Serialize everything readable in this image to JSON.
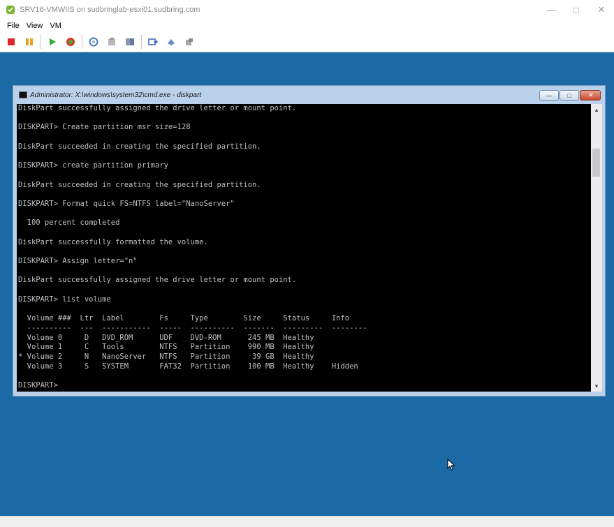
{
  "window": {
    "title": "SRV16-VMWIIS on sudbringlab-esxi01.sudbring.com",
    "controls": [
      "minimize",
      "maximize",
      "close"
    ]
  },
  "menu": {
    "items": [
      "File",
      "View",
      "VM"
    ]
  },
  "toolbar": {
    "buttons": [
      {
        "name": "power-off",
        "icon": "stop-icon",
        "color": "#e0262b"
      },
      {
        "name": "suspend",
        "icon": "pause-icon",
        "color": "#e8a21c"
      },
      {
        "name": "power-on",
        "icon": "play-icon",
        "color": "#37a83a"
      },
      {
        "name": "reset",
        "icon": "reset-icon",
        "color": "#d23b2a"
      },
      {
        "name": "snapshot",
        "icon": "snapshot-icon"
      },
      {
        "name": "revert-snapshot",
        "icon": "revert-snapshot-icon"
      },
      {
        "name": "manage-snapshots",
        "icon": "manage-snapshots-icon"
      },
      {
        "name": "full-screen",
        "icon": "full-screen-icon"
      },
      {
        "name": "send-ctrl-alt-del",
        "icon": "ctrl-alt-del-icon"
      },
      {
        "name": "settings",
        "icon": "settings-icon"
      }
    ]
  },
  "guest": {
    "background_color": "#1b6aa6"
  },
  "cmd": {
    "title": "Administrator: X:\\windows\\system32\\cmd.exe - diskpart",
    "lines": [
      "DiskPart successfully assigned the drive letter or mount point.",
      "",
      "DISKPART> Create partition msr size=128",
      "",
      "DiskPart succeeded in creating the specified partition.",
      "",
      "DISKPART> create partition primary",
      "",
      "DiskPart succeeded in creating the specified partition.",
      "",
      "DISKPART> Format quick FS=NTFS label=\"NanoServer\"",
      "",
      "  100 percent completed",
      "",
      "DiskPart successfully formatted the volume.",
      "",
      "DISKPART> Assign letter=\"n\"",
      "",
      "DiskPart successfully assigned the drive letter or mount point.",
      "",
      "DISKPART> list volume",
      "",
      "  Volume ###  Ltr  Label        Fs     Type        Size     Status     Info",
      "  ----------  ---  -----------  -----  ----------  -------  ---------  --------",
      "  Volume 0     D   DVD_ROM      UDF    DVD-ROM      245 MB  Healthy",
      "  Volume 1     C   Tools        NTFS   Partition    990 MB  Healthy",
      "* Volume 2     N   NanoServer   NTFS   Partition     39 GB  Healthy",
      "  Volume 3     S   SYSTEM       FAT32  Partition    100 MB  Healthy    Hidden",
      "",
      "DISKPART>"
    ]
  }
}
